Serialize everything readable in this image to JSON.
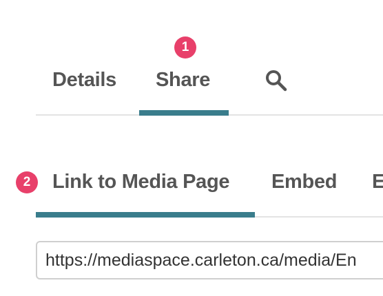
{
  "tabs": {
    "details_label": "Details",
    "share_label": "Share",
    "search_icon": "search-icon",
    "active_tab": "Share"
  },
  "markers": {
    "first": "1",
    "second": "2"
  },
  "share_subtabs": {
    "link_label": "Link to Media Page",
    "embed_label": "Embed",
    "more_label": "E",
    "active_subtab": "Link to Media Page"
  },
  "link_field": {
    "value": "https://mediaspace.carleton.ca/media/En"
  },
  "colors": {
    "accent": "#3a7d8c",
    "marker": "#e8406a",
    "tab_text": "#555555",
    "divider": "#e3e3e3"
  }
}
